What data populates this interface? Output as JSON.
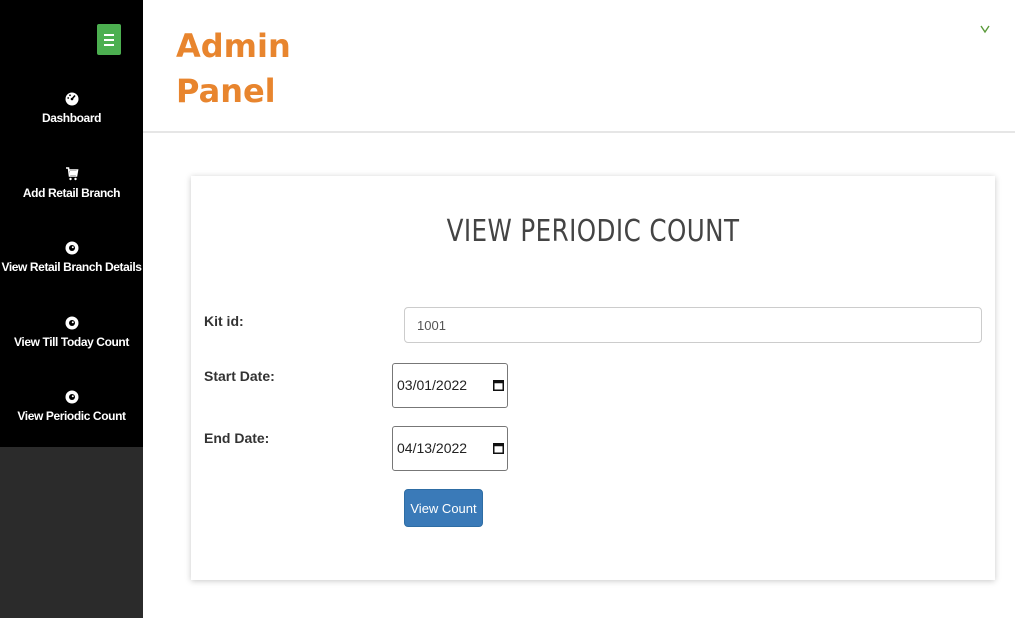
{
  "header": {
    "title": "Admin Panel"
  },
  "sidebar": {
    "items": [
      {
        "label": "Dashboard",
        "icon": "dashboard-icon"
      },
      {
        "label": "Add Retail Branch",
        "icon": "cart-icon"
      },
      {
        "label": "View Retail Branch Details",
        "icon": "eye-icon"
      },
      {
        "label": "View Till Today Count",
        "icon": "eye-icon"
      },
      {
        "label": "View Periodic Count",
        "icon": "eye-icon"
      }
    ]
  },
  "form": {
    "title": "VIEW PERIODIC COUNT",
    "kit_id_label": "Kit id:",
    "kit_id_value": "1001",
    "start_date_label": "Start Date:",
    "start_date_value": "03/01/2022",
    "end_date_label": "End Date:",
    "end_date_value": "04/13/2022",
    "submit_label": "View Count"
  },
  "colors": {
    "accent": "#e8852e",
    "toggle": "#4caf50",
    "button": "#3a7ab8",
    "sidebar": "#000000"
  }
}
